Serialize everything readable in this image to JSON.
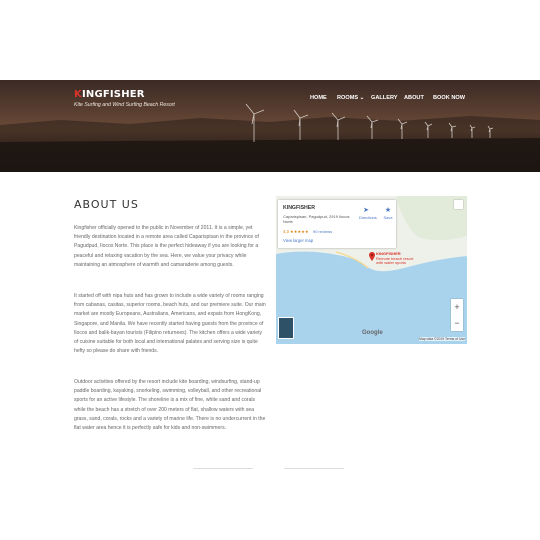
{
  "header": {
    "brand_k": "K",
    "brand_rest": "INGFISHER",
    "tagline": "Kite Surfing and Wind Surfing Beach Resort",
    "nav": [
      "HOME",
      "ROOMS ⌄",
      "GALLERY",
      "ABOUT",
      "BOOK NOW"
    ]
  },
  "about": {
    "title": "ABOUT US",
    "p1": "Kingfisher officially opened to the public in November of 2011. It is a simple, yet friendly destination located in a remote area called Caparispisan in the province of Pagudpud, Ilocos Norte. This place is the perfect hideaway if you are looking for a peaceful and relaxing vacation by the sea. Here, we value your privacy while maintaining an atmosphere of warmth and camaraderie among guests.",
    "p2": "It started off with nipa huts and has grown to include a wide variety of rooms ranging from cabanas, casitas, superior rooms, beach huts, and our premiere suite. Our main market are mostly Europeans, Australians, Americans, and expats from HongKong, Singapore, and Manila. We have recently started having guests from the province of Ilocos and balik-bayan tourists (Filipino returnees). The kitchen offers a wide variety of cuisine suitable for both local and international palates and serving size is quite hefty so please do share with friends.",
    "p3": "Outdoor activities offered by the resort include kite boarding, windsurfing, stand-up paddle boarding, kayaking, snorkeling, swimming, volleyball, and other recreational sports for an active lifestyle. The shoreline is a mix of fine, white sand and corals while the beach has a stretch of over 200 meters of flat, shallow waters with sea grass, sand, corals, rocks and a variety of marine life. There is no undercurrent in the flat water area hence it is perfectly safe for kids and non-swimmers."
  },
  "map": {
    "title": "KINGFISHER",
    "address": "Caparispisan, Pagudpud, 2919 Ilocos Norte",
    "rating": "4.3 ★★★★★",
    "reviews": "90 reviews",
    "larger_map": "View larger map",
    "directions": "Directions",
    "save": "Save",
    "pin_label_1": "KINGFISHER",
    "pin_label_2": "Remote beach resort",
    "pin_label_3": "with water sports",
    "zoom_in": "+",
    "zoom_out": "−",
    "google": "Google",
    "map_data": "Map data ©2019   Terms of Use",
    "colors": {
      "water": "#a9d3ec",
      "land": "#eef0ea",
      "pin": "#d9342b",
      "link": "#4a76c6"
    }
  }
}
